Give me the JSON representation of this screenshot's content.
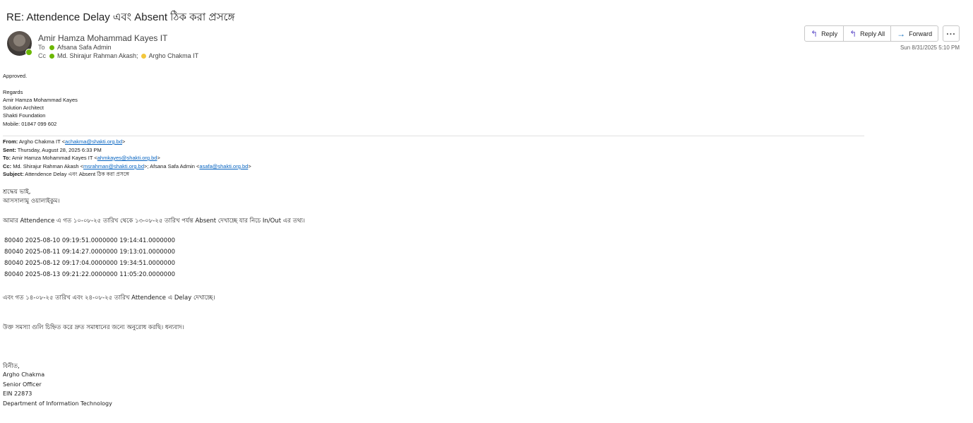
{
  "subject": "RE: Attendence Delay এবং Absent ঠিক করা প্রসঙ্গে",
  "sender": {
    "name": "Amir Hamza Mohammad Kayes IT",
    "to_label": "To",
    "to": "Afsana Safa Admin",
    "cc_label": "Cc",
    "cc1": "Md. Shirajur Rahman Akash;",
    "cc2": "Argho Chakma IT"
  },
  "actions": {
    "reply": "Reply",
    "reply_all": "Reply All",
    "forward": "Forward",
    "more": "···"
  },
  "timestamp": "Sun 8/31/2025 5:10 PM",
  "reply_body": {
    "approved": "Approved.",
    "regards": "Regards",
    "name": "Amir Hamza Mohammad Kayes",
    "title": "Solution Architect",
    "org": "Shakti Foundation",
    "mobile": "Mobile: 01847 099 602"
  },
  "quoted_header": {
    "from_label": "From:",
    "from_name": "Argho Chakma IT <",
    "from_email": "achakma@shakti.org.bd",
    "from_close": ">",
    "sent_label": "Sent:",
    "sent_value": "Thursday, August 28, 2025 6:33 PM",
    "to_label": "To:",
    "to_name": "Amir Hamza Mohammad Kayes IT <",
    "to_email": "ahmkayes@shakti.org.bd",
    "to_close": ">",
    "cc_label": "Cc:",
    "cc_name1": "Md. Shirajur Rahman Akash <",
    "cc_email1": "msrahman@shakti.org.bd",
    "cc_mid": ">; Afsana Safa Admin <",
    "cc_email2": "asafa@shakti.org.bd",
    "cc_close": ">",
    "subject_label": "Subject:",
    "subject_value": "Attendence Delay এবং Absent ঠিক করা প্রসঙ্গে"
  },
  "quoted_body": {
    "greeting1": "শ্রদ্ধেয় ভাই,",
    "greeting2": "আসসালামু ওয়ালাইকুম।",
    "intro": "আমার Attendence এ গত ১০-০৮-২৫ তারিখ থেকে ১৩-০৮-২৫ তারিখ পর্যন্ত Absent দেখাচ্ছে যার নিচে In/Out এর তথ্য।",
    "records": [
      "80040 2025-08-10 09:19:51.0000000 19:14:41.0000000",
      "80040 2025-08-11 09:14:27.0000000 19:13:01.0000000",
      "80040 2025-08-12 09:17:04.0000000 19:34:51.0000000",
      "80040 2025-08-13 09:21:22.0000000 11:05:20.0000000"
    ],
    "delay_note": "এবং গত ১৪-০৮-২৫ তারিখ এবং ২৪-০৮-২৫ তারিখ Attendence এ Delay দেখাচ্ছে।",
    "request": "উক্ত সমস্যা গুলি চিহ্নিত করে দ্রুত সমাধানের জন্যে অনুরোধ করছি। ধন্যবাদ।",
    "closing": "বিনীত,",
    "sig_name": "Argho  Chakma",
    "sig_title": "Senior  Officer",
    "sig_ein": "EIN  22873",
    "sig_dept": "Department  of  Information  Technology"
  }
}
